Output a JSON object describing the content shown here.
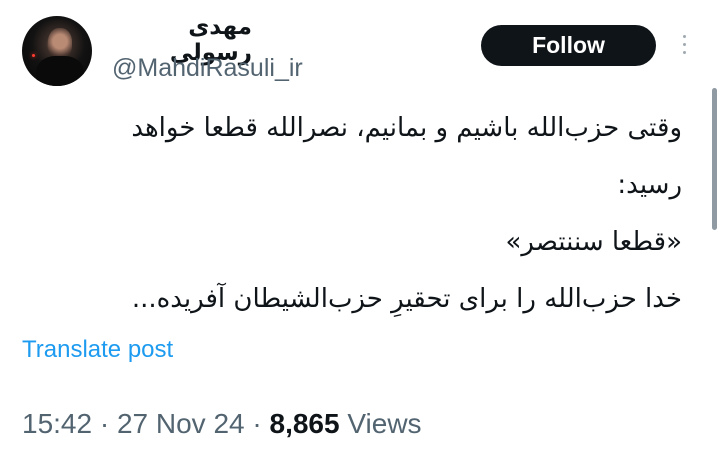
{
  "author": {
    "display_name": "مهدی رسولی",
    "handle": "@MahdiRasuli_ir",
    "avatar_icon": "profile-photo"
  },
  "follow_button": {
    "label": "Follow"
  },
  "more_menu": {
    "icon": "more-vertical-icon"
  },
  "tweet": {
    "lines": [
      "وقتی حزب‌الله باشیم و بمانیم، نصرالله قطعا خواهد",
      "رسید:",
      "«قطعا سننتصر»",
      "خدا حزب‌الله را برای تحقیرِ حزب‌الشیطان آفریده..."
    ]
  },
  "translate": {
    "label": "Translate post"
  },
  "meta": {
    "time": "15:42",
    "separator": "·",
    "date": "27 Nov 24",
    "views_count": "8,865",
    "views_label": "Views"
  },
  "colors": {
    "accent": "#1d9bf0",
    "text_primary": "#0f1419",
    "text_secondary": "#536471",
    "button_bg": "#0f1419"
  }
}
